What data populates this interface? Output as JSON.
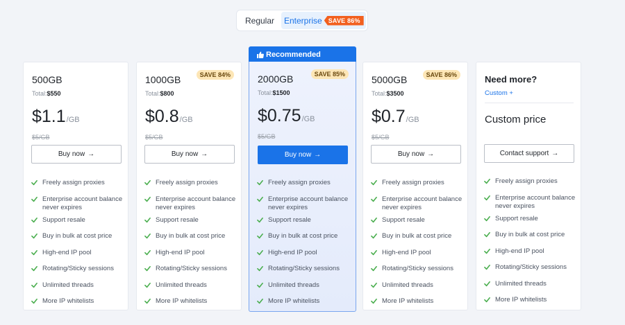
{
  "toggle": {
    "regular": "Regular",
    "enterprise": "Enterprise",
    "save_tag": "SAVE 86%"
  },
  "recommended_label": "Recommended",
  "features": [
    "Freely assign proxies",
    "Enterprise account balance never expires",
    "Support resale",
    "Buy in bulk at cost price",
    "High-end IP pool",
    "Rotating/Sticky sessions",
    "Unlimited threads",
    "More IP whitelists"
  ],
  "plans": [
    {
      "title": "500GB",
      "total_label": "Total:",
      "total": "$550",
      "price": "$1.1",
      "unit": "/GB",
      "old": "$5/GB",
      "button": "Buy now",
      "badge": ""
    },
    {
      "title": "1000GB",
      "total_label": "Total:",
      "total": "$800",
      "price": "$0.8",
      "unit": "/GB",
      "old": "$5/GB",
      "button": "Buy now",
      "badge": "SAVE 84%"
    },
    {
      "title": "2000GB",
      "total_label": "Total:",
      "total": "$1500",
      "price": "$0.75",
      "unit": "/GB",
      "old": "$5/GB",
      "button": "Buy now",
      "badge": "SAVE 85%"
    },
    {
      "title": "5000GB",
      "total_label": "Total:",
      "total": "$3500",
      "price": "$0.7",
      "unit": "/GB",
      "old": "$5/GB",
      "button": "Buy now",
      "badge": "SAVE 86%"
    }
  ],
  "custom": {
    "title": "Need more?",
    "link": "Custom +",
    "price": "Custom price",
    "button": "Contact support"
  },
  "colors": {
    "accent": "#1a73e8",
    "check": "#4caf50",
    "save_tag": "#f2601f",
    "badge_bg": "#fde6b6"
  }
}
